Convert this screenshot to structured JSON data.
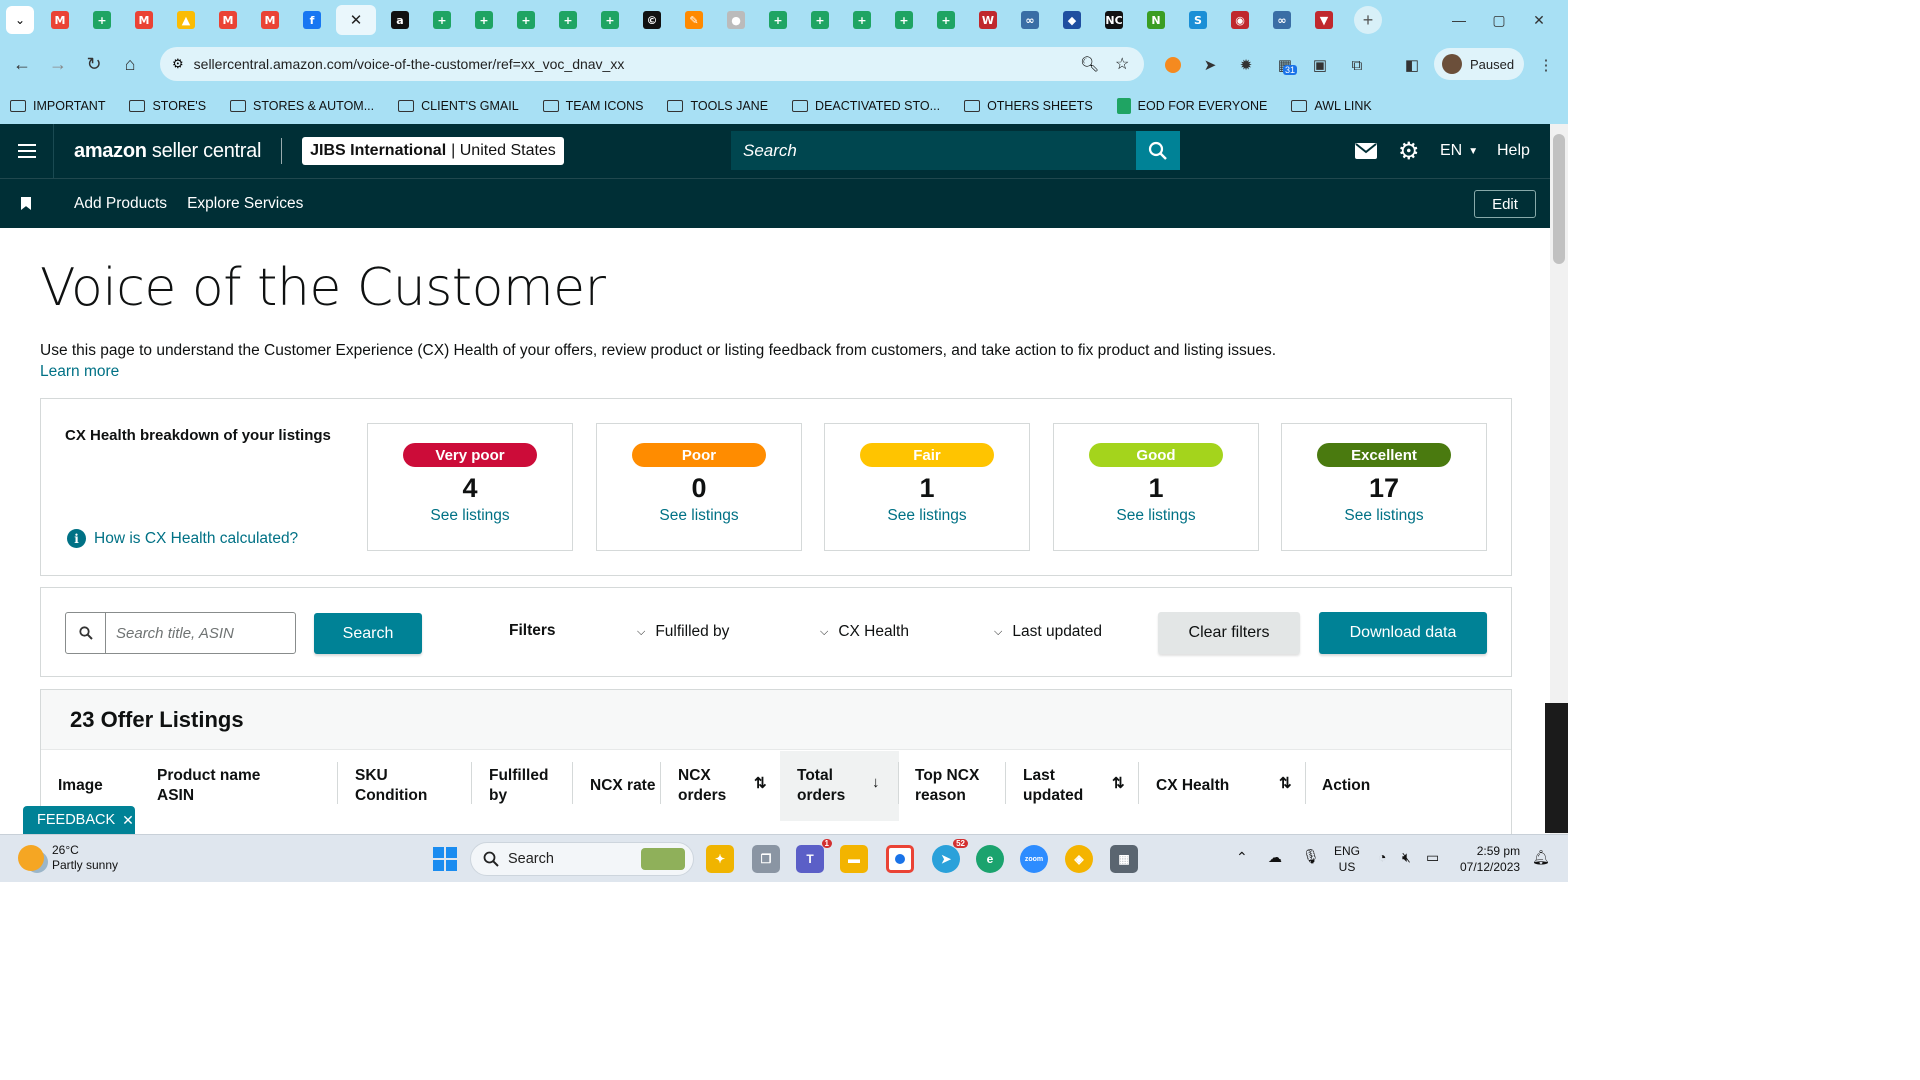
{
  "browser": {
    "tabs": [
      {
        "icon": "gmail-icon",
        "color": "#ea4335",
        "glyph": "M"
      },
      {
        "icon": "sheets-icon",
        "color": "#1fa463",
        "glyph": "+"
      },
      {
        "icon": "gmail-icon",
        "color": "#ea4335",
        "glyph": "M"
      },
      {
        "icon": "drive-icon",
        "color": "#fbbc04",
        "glyph": "▲"
      },
      {
        "icon": "gmail-icon",
        "color": "#ea4335",
        "glyph": "M"
      },
      {
        "icon": "gmail-icon",
        "color": "#ea4335",
        "glyph": "M"
      },
      {
        "icon": "facebook-icon",
        "color": "#1877f2",
        "glyph": "f"
      },
      {
        "icon": "close-icon",
        "color": "#eaf7fc",
        "glyph": "✕",
        "active": true
      },
      {
        "icon": "amazon-icon",
        "color": "#111111",
        "glyph": "a"
      },
      {
        "icon": "sheets-icon",
        "color": "#1fa463",
        "glyph": "+"
      },
      {
        "icon": "sheets-icon",
        "color": "#1fa463",
        "glyph": "+"
      },
      {
        "icon": "sheets-icon",
        "color": "#1fa463",
        "glyph": "+"
      },
      {
        "icon": "sheets-icon",
        "color": "#1fa463",
        "glyph": "+"
      },
      {
        "icon": "sheets-icon",
        "color": "#1fa463",
        "glyph": "+"
      },
      {
        "icon": "copyright-icon",
        "color": "#111111",
        "glyph": "©"
      },
      {
        "icon": "pencil-icon",
        "color": "#ff8a00",
        "glyph": "✎"
      },
      {
        "icon": "circle-icon",
        "color": "#bbbbbb",
        "glyph": "●"
      },
      {
        "icon": "sheets-icon",
        "color": "#1fa463",
        "glyph": "+"
      },
      {
        "icon": "sheets-icon",
        "color": "#1fa463",
        "glyph": "+"
      },
      {
        "icon": "sheets-icon",
        "color": "#1fa463",
        "glyph": "+"
      },
      {
        "icon": "sheets-icon",
        "color": "#1fa463",
        "glyph": "+"
      },
      {
        "icon": "sheets-icon",
        "color": "#1fa463",
        "glyph": "+"
      },
      {
        "icon": "w-icon",
        "color": "#c0282d",
        "glyph": "W"
      },
      {
        "icon": "logo-icon",
        "color": "#3a6ea5",
        "glyph": "∞"
      },
      {
        "icon": "logo-icon",
        "color": "#1f4fa0",
        "glyph": "◆"
      },
      {
        "icon": "nc-icon",
        "color": "#111111",
        "glyph": "NC"
      },
      {
        "icon": "n-icon",
        "color": "#3a9d23",
        "glyph": "N"
      },
      {
        "icon": "sysco-icon",
        "color": "#1a8fd6",
        "glyph": "S"
      },
      {
        "icon": "circle-logo-icon",
        "color": "#c0282d",
        "glyph": "◉"
      },
      {
        "icon": "logo-icon",
        "color": "#3a6ea5",
        "glyph": "∞"
      },
      {
        "icon": "triangle-icon",
        "color": "#c0282d",
        "glyph": "▼"
      }
    ],
    "url": "sellercentral.amazon.com/voice-of-the-customer/ref=xx_voc_dnav_xx",
    "profile": "Paused",
    "bookmarks": [
      {
        "type": "folder",
        "label": "IMPORTANT"
      },
      {
        "type": "folder",
        "label": "STORE'S"
      },
      {
        "type": "folder",
        "label": "STORES & AUTOM..."
      },
      {
        "type": "folder",
        "label": "CLIENT'S GMAIL"
      },
      {
        "type": "folder",
        "label": "TEAM ICONS"
      },
      {
        "type": "folder",
        "label": "TOOLS JANE"
      },
      {
        "type": "folder",
        "label": "DEACTIVATED STO..."
      },
      {
        "type": "folder",
        "label": "OTHERS SHEETS"
      },
      {
        "type": "sheet",
        "label": "EOD FOR EVERYONE"
      },
      {
        "type": "folder",
        "label": "AWL LINK"
      }
    ],
    "ext_badge": "31"
  },
  "header": {
    "logo_light": "amazon",
    "logo_rest": " seller central",
    "store_name": "JIBS International",
    "store_sep": " | ",
    "store_region": "United States",
    "search_placeholder": "Search",
    "lang": "EN",
    "help": "Help"
  },
  "subnav": {
    "items": [
      "Add Products",
      "Explore Services"
    ],
    "edit": "Edit"
  },
  "page": {
    "title": "Voice of the Customer",
    "description": "Use this page to understand the Customer Experience (CX) Health of your offers, review product or listing feedback from customers, and take action to fix product and listing issues.",
    "learn_more": "Learn more"
  },
  "cx": {
    "label": "CX Health breakdown of your listings",
    "how": "How is CX Health calculated?",
    "tiles": [
      {
        "label": "Very poor",
        "count": "4",
        "link": "See listings",
        "color": "#cc0c39"
      },
      {
        "label": "Poor",
        "count": "0",
        "link": "See listings",
        "color": "#ff8c00"
      },
      {
        "label": "Fair",
        "count": "1",
        "link": "See listings",
        "color": "#ffc400"
      },
      {
        "label": "Good",
        "count": "1",
        "link": "See listings",
        "color": "#a4d41c"
      },
      {
        "label": "Excellent",
        "count": "17",
        "link": "See listings",
        "color": "#4a7a0f"
      }
    ]
  },
  "filters": {
    "search_placeholder": "Search title, ASIN",
    "search_button": "Search",
    "label": "Filters",
    "dropdowns": [
      "Fulfilled by",
      "CX Health",
      "Last updated"
    ],
    "clear": "Clear filters",
    "download": "Download data"
  },
  "table": {
    "title": "23 Offer Listings",
    "columns": [
      {
        "l1": "Image",
        "l2": ""
      },
      {
        "l1": "Product name",
        "l2": "ASIN"
      },
      {
        "l1": "SKU",
        "l2": "Condition"
      },
      {
        "l1": "Fulfilled",
        "l2": "by"
      },
      {
        "l1": "NCX rate",
        "l2": ""
      },
      {
        "l1": "NCX",
        "l2": "orders"
      },
      {
        "l1": "Total",
        "l2": "orders"
      },
      {
        "l1": "Top NCX",
        "l2": "reason"
      },
      {
        "l1": "Last",
        "l2": "updated"
      },
      {
        "l1": "CX Health",
        "l2": ""
      },
      {
        "l1": "Action",
        "l2": ""
      }
    ]
  },
  "feedback": "FEEDBACK",
  "taskbar": {
    "temp": "26°C",
    "weather": "Partly sunny",
    "search": "Search",
    "lang1": "ENG",
    "lang2": "US",
    "time": "2:59 pm",
    "date": "07/12/2023",
    "telegram_badge": "52",
    "teams_badge": "1"
  }
}
